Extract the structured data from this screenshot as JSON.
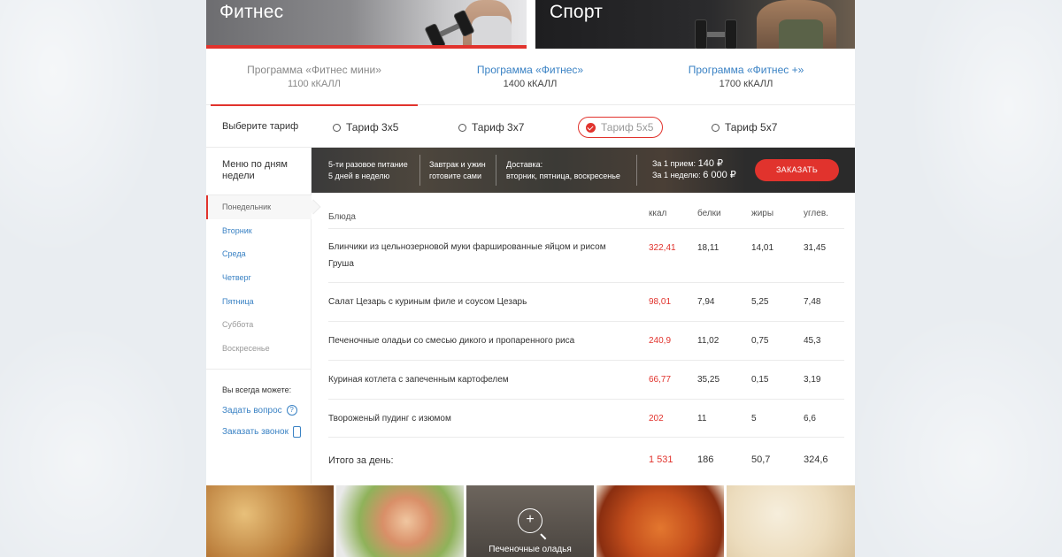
{
  "banners": {
    "fitness": {
      "title": "Фитнес"
    },
    "sport": {
      "title": "Спорт"
    }
  },
  "programs": [
    {
      "name": "Программа «Фитнес мини»",
      "kcal": "1100 кКАЛЛ",
      "active": true
    },
    {
      "name": "Программа «Фитнес»",
      "kcal": "1400 кКАЛЛ",
      "active": false
    },
    {
      "name": "Программа «Фитнес +»",
      "kcal": "1700 кКАЛЛ",
      "active": false
    }
  ],
  "tariffs": {
    "label": "Выберите тариф",
    "options": [
      "Тариф 3х5",
      "Тариф 3х7",
      "Тариф 5х5",
      "Тариф 5х7"
    ],
    "selected": "Тариф 5х5"
  },
  "sidebar": {
    "menu_title": "Меню по дням недели",
    "days": [
      "Понедельник",
      "Вторник",
      "Среда",
      "Четверг",
      "Пятница",
      "Суббота",
      "Воскресенье"
    ],
    "always_title": "Вы всегда можете:",
    "ask_label": "Задать вопрос",
    "call_label": "Заказать звонок"
  },
  "infobar": {
    "col1_line1": "5-ти разовое питание",
    "col1_line2": "5 дней в неделю",
    "col2_line1": "Завтрак и ужин",
    "col2_line2": "готовите сами",
    "col3_line1": "Доставка:",
    "col3_line2": "вторник, пятница, воскресенье",
    "price_per_meal_label": "За 1 прием:",
    "price_per_meal": "140 ₽",
    "price_per_week_label": "За 1 неделю:",
    "price_per_week": "6 000 ₽",
    "order_label": "ЗАКАЗАТЬ"
  },
  "table": {
    "headers": {
      "name": "Блюда",
      "kcal": "ккал",
      "protein": "белки",
      "fat": "жиры",
      "carbs": "углев."
    },
    "rows": [
      {
        "name_line1": "Блинчики из цельнозерновой муки фаршированные яйцом и рисом",
        "name_line2": "Груша",
        "kcal": "322,41",
        "protein": "18,11",
        "fat": "14,01",
        "carbs": "31,45"
      },
      {
        "name_line1": "Салат Цезарь с куриным филе и соусом Цезарь",
        "name_line2": "",
        "kcal": "98,01",
        "protein": "7,94",
        "fat": "5,25",
        "carbs": "7,48"
      },
      {
        "name_line1": "Печеночные оладьи со смесью дикого и пропаренного риса",
        "name_line2": "",
        "kcal": "240,9",
        "protein": "11,02",
        "fat": "0,75",
        "carbs": "45,3"
      },
      {
        "name_line1": "Куриная котлета с запеченным картофелем",
        "name_line2": "",
        "kcal": "66,77",
        "protein": "35,25",
        "fat": "0,15",
        "carbs": "3,19"
      },
      {
        "name_line1": "Твороженый пудинг с изюмом",
        "name_line2": "",
        "kcal": "202",
        "protein": "11",
        "fat": "5",
        "carbs": "6,6"
      }
    ],
    "total": {
      "label": "Итого за день:",
      "kcal": "1 531",
      "protein": "186",
      "fat": "50,7",
      "carbs": "324,6"
    }
  },
  "photos": {
    "caption": "Печеночные оладья"
  },
  "colors": {
    "accent": "#e1332d",
    "link": "#3a82c4"
  }
}
